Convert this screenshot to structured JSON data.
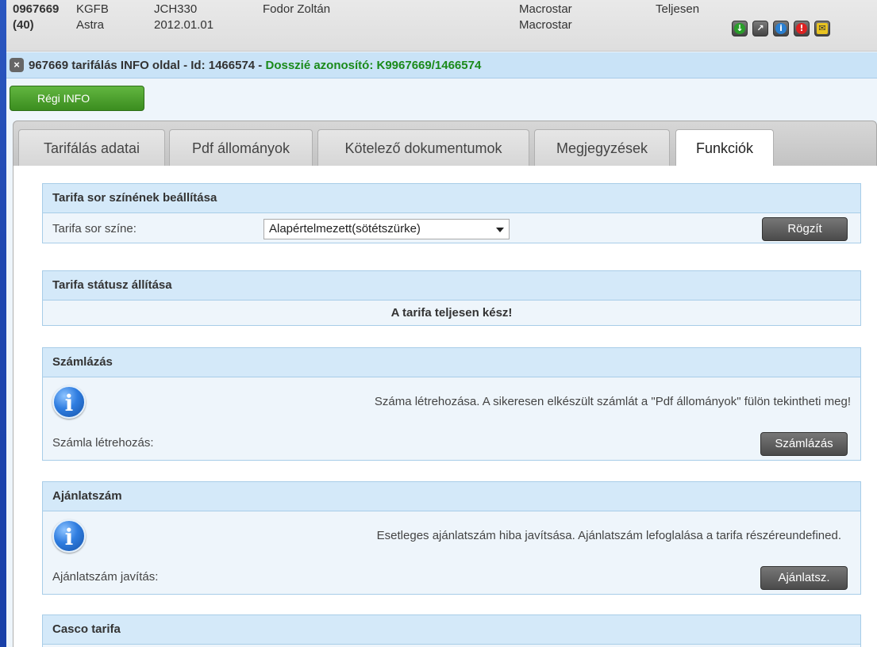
{
  "header": {
    "id": "0967669",
    "count": "(40)",
    "type": "KGFB",
    "make": "Astra",
    "plate": "JCH330",
    "date": "2012.01.01",
    "person": "Fodor Zoltán",
    "agency1": "Macrostar",
    "agency2": "Macrostar",
    "status": "Teljesen",
    "icons": [
      "download-icon",
      "arrow-icon",
      "info-icon",
      "alert-icon",
      "mail-icon"
    ]
  },
  "titlebar": {
    "close_glyph": "×",
    "text": "967669 tarifálás INFO oldal - Id: 1466574 - ",
    "dossier": "Dosszié azonosító: K9967669/1466574"
  },
  "regi_button": "Régi INFO",
  "tabs": [
    "Tarifálás adatai",
    "Pdf állományok",
    "Kötelező dokumentumok",
    "Megjegyzések",
    "Funkciók"
  ],
  "active_tab": "Funkciók",
  "panels": {
    "color": {
      "title": "Tarifa sor színének beállítása",
      "label": "Tarifa sor színe:",
      "select_value": "Alapértelmezett(sötétszürke)",
      "button": "Rögzít"
    },
    "status": {
      "title": "Tarifa státusz állítása",
      "message": "A tarifa teljesen kész!"
    },
    "billing": {
      "title": "Számlázás",
      "info": "Száma létrehozása. A sikeresen elkészült számlát a \"Pdf állományok\" fülön tekintheti meg!",
      "label": "Számla létrehozás:",
      "button": "Számlázás"
    },
    "offer": {
      "title": "Ajánlatszám",
      "info": "Esetleges ajánlatszám hiba javítsása. Ajánlatszám lefoglalása a tarifa részéreundefined.",
      "label": "Ajánlatszám javítás:",
      "button": "Ajánlatsz."
    },
    "casco": {
      "title": "Casco tarifa"
    }
  },
  "colors": {
    "accent_green": "#1a8a1a",
    "panel_header": "#d4e9f9",
    "background_blue": "#1e47b0"
  }
}
